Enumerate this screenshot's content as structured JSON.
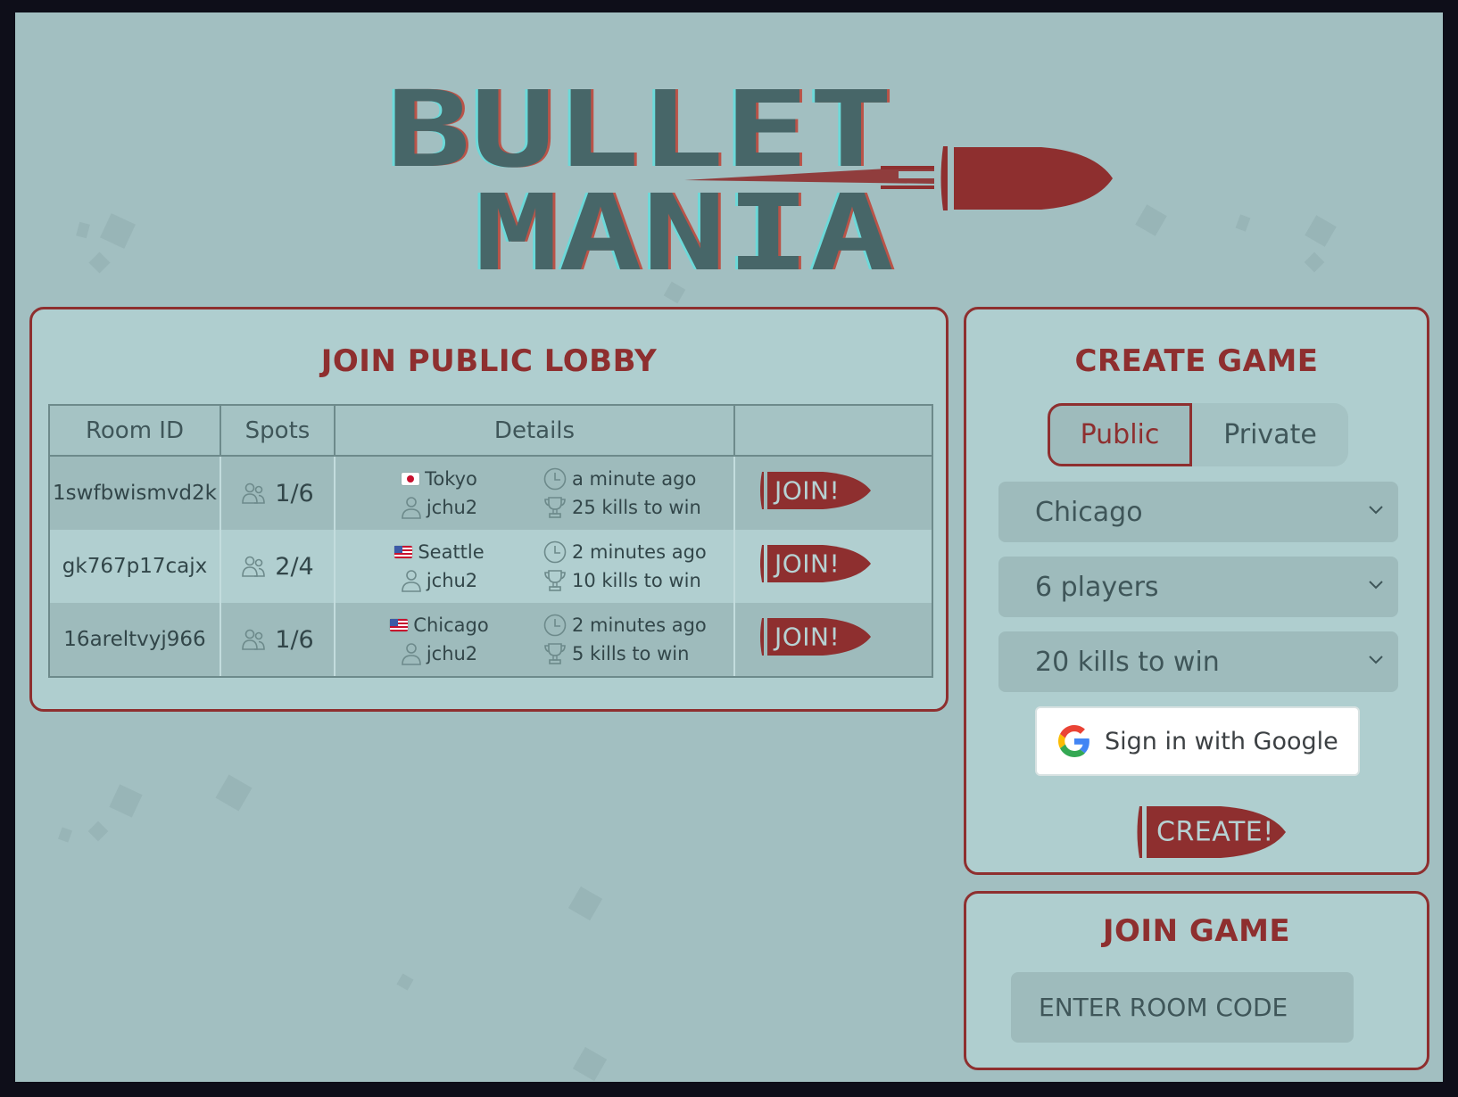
{
  "app": {
    "title_line1": "BULLET",
    "title_line2": "MANIA"
  },
  "lobby": {
    "title": "JOIN PUBLIC LOBBY",
    "columns": [
      "Room ID",
      "Spots",
      "Details",
      ""
    ],
    "rows": [
      {
        "room_id": "1swfbwismvd2k",
        "spots": "1/6",
        "location": "Tokyo",
        "flag": "jp",
        "host": "jchu2",
        "created": "a minute ago",
        "goal": "25 kills to win",
        "join_label": "JOIN!"
      },
      {
        "room_id": "gk767p17cajx",
        "spots": "2/4",
        "location": "Seattle",
        "flag": "us",
        "host": "jchu2",
        "created": "2 minutes ago",
        "goal": "10 kills to win",
        "join_label": "JOIN!"
      },
      {
        "room_id": "16areltvyj966",
        "spots": "1/6",
        "location": "Chicago",
        "flag": "us",
        "host": "jchu2",
        "created": "2 minutes ago",
        "goal": "5 kills to win",
        "join_label": "JOIN!"
      }
    ]
  },
  "create": {
    "title": "CREATE GAME",
    "visibility_options": [
      "Public",
      "Private"
    ],
    "visibility_selected": "Public",
    "region": "Chicago",
    "players": "6 players",
    "kills": "20 kills to win",
    "google_label": "Sign in with Google",
    "create_label": "CREATE!"
  },
  "join": {
    "title": "JOIN GAME",
    "placeholder": "ENTER ROOM CODE",
    "value": ""
  },
  "colors": {
    "accent": "#8e2f2f",
    "panel": "#afcecf",
    "background": "#a2bfc1",
    "text": "#3f5659"
  }
}
